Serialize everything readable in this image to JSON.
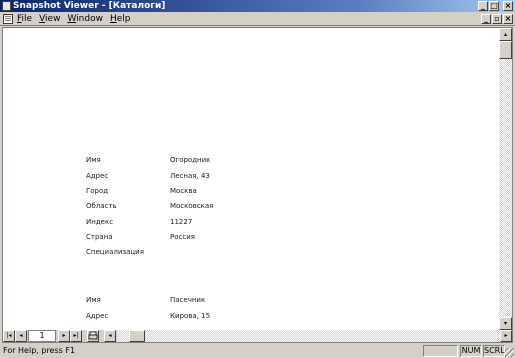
{
  "window": {
    "title": "Snapshot Viewer - [Каталоги]",
    "minimize_glyph": "_",
    "maximize_glyph": "□",
    "close_glyph": "×",
    "restore_glyph": "▫"
  },
  "menu": {
    "items": [
      {
        "label": "File"
      },
      {
        "label": "View"
      },
      {
        "label": "Window"
      },
      {
        "label": "Help"
      }
    ]
  },
  "document": {
    "records": [
      {
        "fields": [
          {
            "label": "Имя",
            "value": "Огородник"
          },
          {
            "label": "Адрес",
            "value": "Лесная, 43"
          },
          {
            "label": "Город",
            "value": "Москва"
          },
          {
            "label": "Область",
            "value": "Московская"
          },
          {
            "label": "Индекс",
            "value": "11227"
          },
          {
            "label": "Страна",
            "value": "Россия"
          },
          {
            "label": "Специализация",
            "value": ""
          }
        ]
      },
      {
        "fields": [
          {
            "label": "Имя",
            "value": "Пасечник"
          },
          {
            "label": "Адрес",
            "value": "Кирова, 15"
          }
        ]
      }
    ]
  },
  "navigation": {
    "page_number": "1",
    "first_glyph": "|◂",
    "prev_glyph": "◂",
    "next_glyph": "▸",
    "last_glyph": "▸|"
  },
  "scroll": {
    "up_glyph": "▴",
    "down_glyph": "▾",
    "left_glyph": "◂",
    "right_glyph": "▸"
  },
  "statusbar": {
    "text": "For Help, press F1",
    "num": "NUM",
    "scrl": "SCRL"
  },
  "icons": {
    "app": "snapshot-viewer-icon",
    "doc": "document-icon",
    "print": "print-icon"
  }
}
